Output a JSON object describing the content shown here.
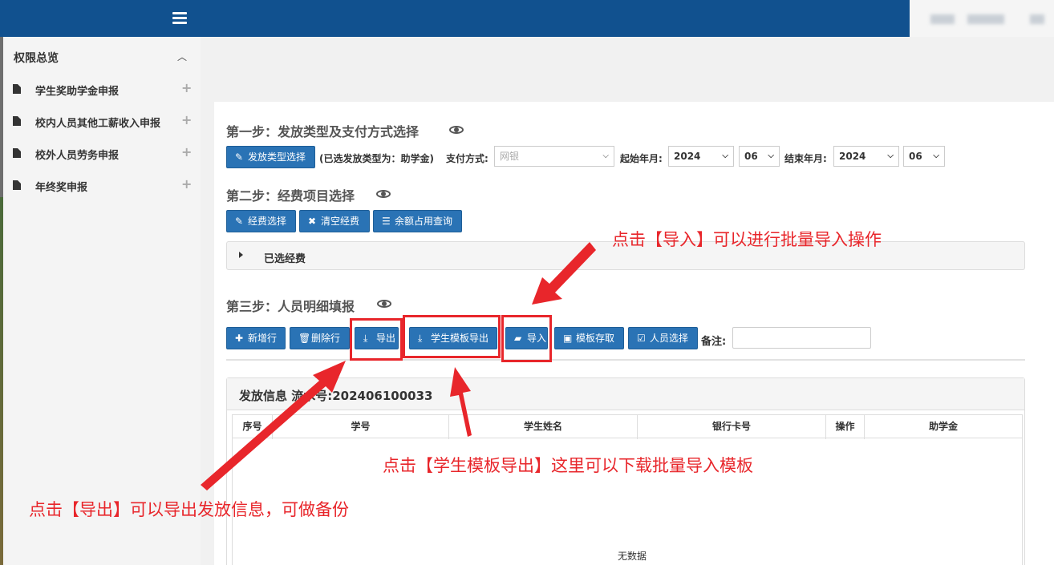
{
  "sidebar": {
    "heading": "权限总览",
    "items": [
      {
        "label": "学生奖助学金申报"
      },
      {
        "label": "校内人员其他工薪收入申报"
      },
      {
        "label": "校外人员劳务申报"
      },
      {
        "label": "年终奖申报"
      }
    ]
  },
  "step1": {
    "title": "第一步：发放类型及支付方式选择",
    "type_button": "发放类型选择",
    "selected_type": "(已选发放类型为：助学金)",
    "pay_label": "支付方式:",
    "pay_placeholder": "网银",
    "start_label": "起始年月:",
    "start_year": "2024",
    "start_month": "06",
    "end_label": "结束年月:",
    "end_year": "2024",
    "end_month": "06"
  },
  "step2": {
    "title": "第二步：经费项目选择",
    "buttons": {
      "select": "经费选择",
      "clear": "清空经费",
      "balance": "余额占用查询"
    },
    "selected_funds": "已选经费"
  },
  "step3": {
    "title": "第三步：人员明细填报",
    "buttons": {
      "add_row": "新增行",
      "delete_row": "删除行",
      "export": "导出",
      "template_export": "学生模板导出",
      "import": "导入",
      "template_save": "模板存取",
      "person_select": "人员选择"
    },
    "remark_label": "备注:"
  },
  "panel": {
    "title": "发放信息 流水号:202406100033",
    "columns": [
      "序号",
      "学号",
      "学生姓名",
      "银行卡号",
      "操作",
      "助学金"
    ],
    "empty_text": "无数据"
  },
  "annotations": {
    "import_note": "点击【导入】可以进行批量导入操作",
    "template_note": "点击【学生模板导出】这里可以下载批量导入模板",
    "export_note": "点击【导出】可以导出发放信息，可做备份"
  },
  "colors": {
    "topbar": "#11518f",
    "button": "#2a73b5",
    "annotation": "#e8262b"
  }
}
